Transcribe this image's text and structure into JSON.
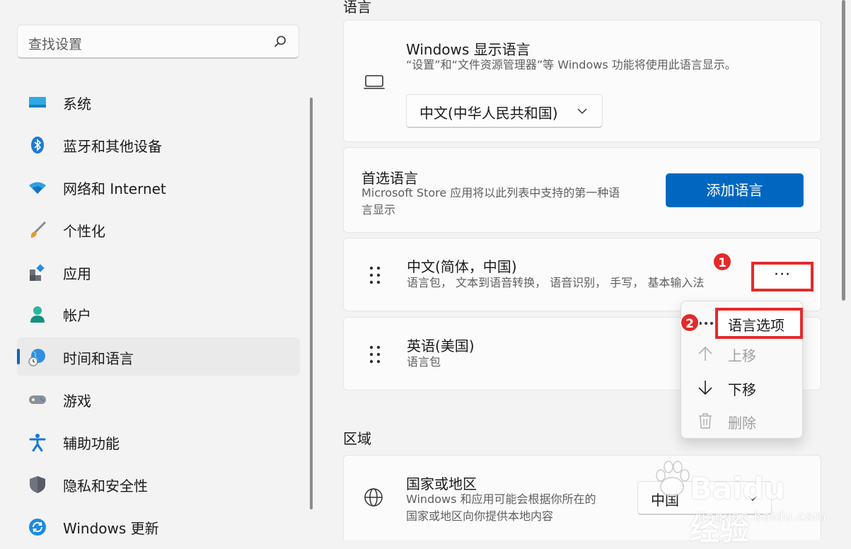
{
  "search": {
    "placeholder": "查找设置"
  },
  "sidebar": {
    "items": [
      {
        "label": "系统",
        "icon": "monitor-icon"
      },
      {
        "label": "蓝牙和其他设备",
        "icon": "bluetooth-icon"
      },
      {
        "label": "网络和 Internet",
        "icon": "wifi-icon"
      },
      {
        "label": "个性化",
        "icon": "brush-icon"
      },
      {
        "label": "应用",
        "icon": "apps-icon"
      },
      {
        "label": "帐户",
        "icon": "person-icon"
      },
      {
        "label": "时间和语言",
        "icon": "globe-clock-icon",
        "active": true
      },
      {
        "label": "游戏",
        "icon": "gamepad-icon"
      },
      {
        "label": "辅助功能",
        "icon": "accessibility-icon"
      },
      {
        "label": "隐私和安全性",
        "icon": "shield-icon"
      },
      {
        "label": "Windows 更新",
        "icon": "update-icon"
      }
    ]
  },
  "language_section": {
    "title": "语言",
    "display_language": {
      "title": "Windows 显示语言",
      "description": "“设置”和“文件资源管理器”等 Windows 功能将使用此语言显示。",
      "selected": "中文(中华人民共和国)"
    },
    "preferred": {
      "title": "首选语言",
      "description_line1": "Microsoft Store 应用将以此列表中支持的第一种语",
      "description_line2": "言显示",
      "add_button": "添加语言"
    },
    "languages": [
      {
        "name": "中文(简体，中国)",
        "features": "语言包， 文本到语音转换， 语音识别， 手写， 基本输入法"
      },
      {
        "name": "英语(美国)",
        "features": "语言包"
      }
    ],
    "more_label": "···"
  },
  "context_menu": {
    "items": [
      {
        "label": "语言选项",
        "icon": "more-icon",
        "disabled": false
      },
      {
        "label": "上移",
        "icon": "arrow-up-icon",
        "disabled": true
      },
      {
        "label": "下移",
        "icon": "arrow-down-icon",
        "disabled": false
      },
      {
        "label": "删除",
        "icon": "trash-icon",
        "disabled": true
      }
    ]
  },
  "annotations": {
    "badge1": "1",
    "badge2": "2"
  },
  "region_section": {
    "title": "区域",
    "country": {
      "title": "国家或地区",
      "description_line1": "Windows 和应用可能会根据你所在的",
      "description_line2": "国家或地区向你提供本地内容",
      "selected": "中国"
    }
  },
  "watermark": {
    "text": "Baidu经验",
    "sub": "jingyan.baidu.com"
  },
  "colors": {
    "accent": "#0067c0",
    "annotation": "#e42a2a"
  }
}
